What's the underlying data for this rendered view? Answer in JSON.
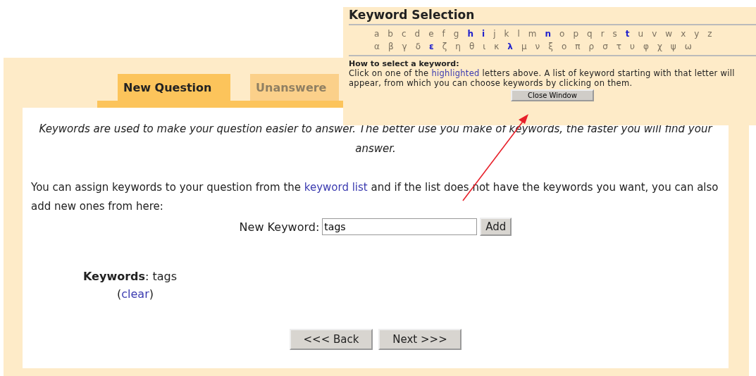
{
  "tabs": [
    {
      "label": "New Question",
      "selected": true
    },
    {
      "label": "Unanswere",
      "selected": false
    }
  ],
  "intro": "Keywords are used to make your question easier to answer. The better use you make of keywords, the faster you will find your answer.",
  "assign": {
    "before": "You can assign keywords to your question from the ",
    "link": "keyword list",
    "after": " and if the list does not have the keywords you want, you can also add new ones from here:"
  },
  "new_keyword": {
    "label": "New Keyword:",
    "value": "tags",
    "button": "Add"
  },
  "keywords": {
    "text": "**Keywords**: tags",
    "open": "(",
    "link": "clear",
    "close": ")"
  },
  "buttons": [
    "<<< Back",
    "Next >>>"
  ],
  "popup": {
    "title": "Keyword Selection",
    "latin": [
      {
        "char": "a",
        "highlighted": false
      },
      {
        "char": "b",
        "highlighted": false
      },
      {
        "char": "c",
        "highlighted": false
      },
      {
        "char": "d",
        "highlighted": false
      },
      {
        "char": "e",
        "highlighted": false
      },
      {
        "char": "f",
        "highlighted": false
      },
      {
        "char": "g",
        "highlighted": false
      },
      {
        "char": "h",
        "highlighted": true
      },
      {
        "char": "i",
        "highlighted": true
      },
      {
        "char": "j",
        "highlighted": false
      },
      {
        "char": "k",
        "highlighted": false
      },
      {
        "char": "l",
        "highlighted": false
      },
      {
        "char": "m",
        "highlighted": false
      },
      {
        "char": "n",
        "highlighted": true
      },
      {
        "char": "o",
        "highlighted": false
      },
      {
        "char": "p",
        "highlighted": false
      },
      {
        "char": "q",
        "highlighted": false
      },
      {
        "char": "r",
        "highlighted": false
      },
      {
        "char": "s",
        "highlighted": false
      },
      {
        "char": "t",
        "highlighted": true
      },
      {
        "char": "u",
        "highlighted": false
      },
      {
        "char": "v",
        "highlighted": false
      },
      {
        "char": "w",
        "highlighted": false
      },
      {
        "char": "x",
        "highlighted": false
      },
      {
        "char": "y",
        "highlighted": false
      },
      {
        "char": "z",
        "highlighted": false
      }
    ],
    "greek": [
      {
        "char": "α",
        "highlighted": false
      },
      {
        "char": "β",
        "highlighted": false
      },
      {
        "char": "γ",
        "highlighted": false
      },
      {
        "char": "δ",
        "highlighted": false
      },
      {
        "char": "ε",
        "highlighted": true
      },
      {
        "char": "ζ",
        "highlighted": false
      },
      {
        "char": "η",
        "highlighted": false
      },
      {
        "char": "θ",
        "highlighted": false
      },
      {
        "char": "ι",
        "highlighted": false
      },
      {
        "char": "κ",
        "highlighted": false
      },
      {
        "char": "λ",
        "highlighted": true
      },
      {
        "char": "μ",
        "highlighted": false
      },
      {
        "char": "ν",
        "highlighted": false
      },
      {
        "char": "ξ",
        "highlighted": false
      },
      {
        "char": "ο",
        "highlighted": false
      },
      {
        "char": "π",
        "highlighted": false
      },
      {
        "char": "ρ",
        "highlighted": false
      },
      {
        "char": "σ",
        "highlighted": false
      },
      {
        "char": "τ",
        "highlighted": false
      },
      {
        "char": "υ",
        "highlighted": false
      },
      {
        "char": "φ",
        "highlighted": false
      },
      {
        "char": "χ",
        "highlighted": false
      },
      {
        "char": "ψ",
        "highlighted": false
      },
      {
        "char": "ω",
        "highlighted": false
      }
    ],
    "how_title": "How to select a keyword:",
    "instructions": {
      "before": "Click on one of the ",
      "link": "highlighted",
      "after": " letters above. A list of keyword starting with that letter will appear, from which you can choose keywords by clicking on them."
    },
    "close_button": "Close Window"
  }
}
